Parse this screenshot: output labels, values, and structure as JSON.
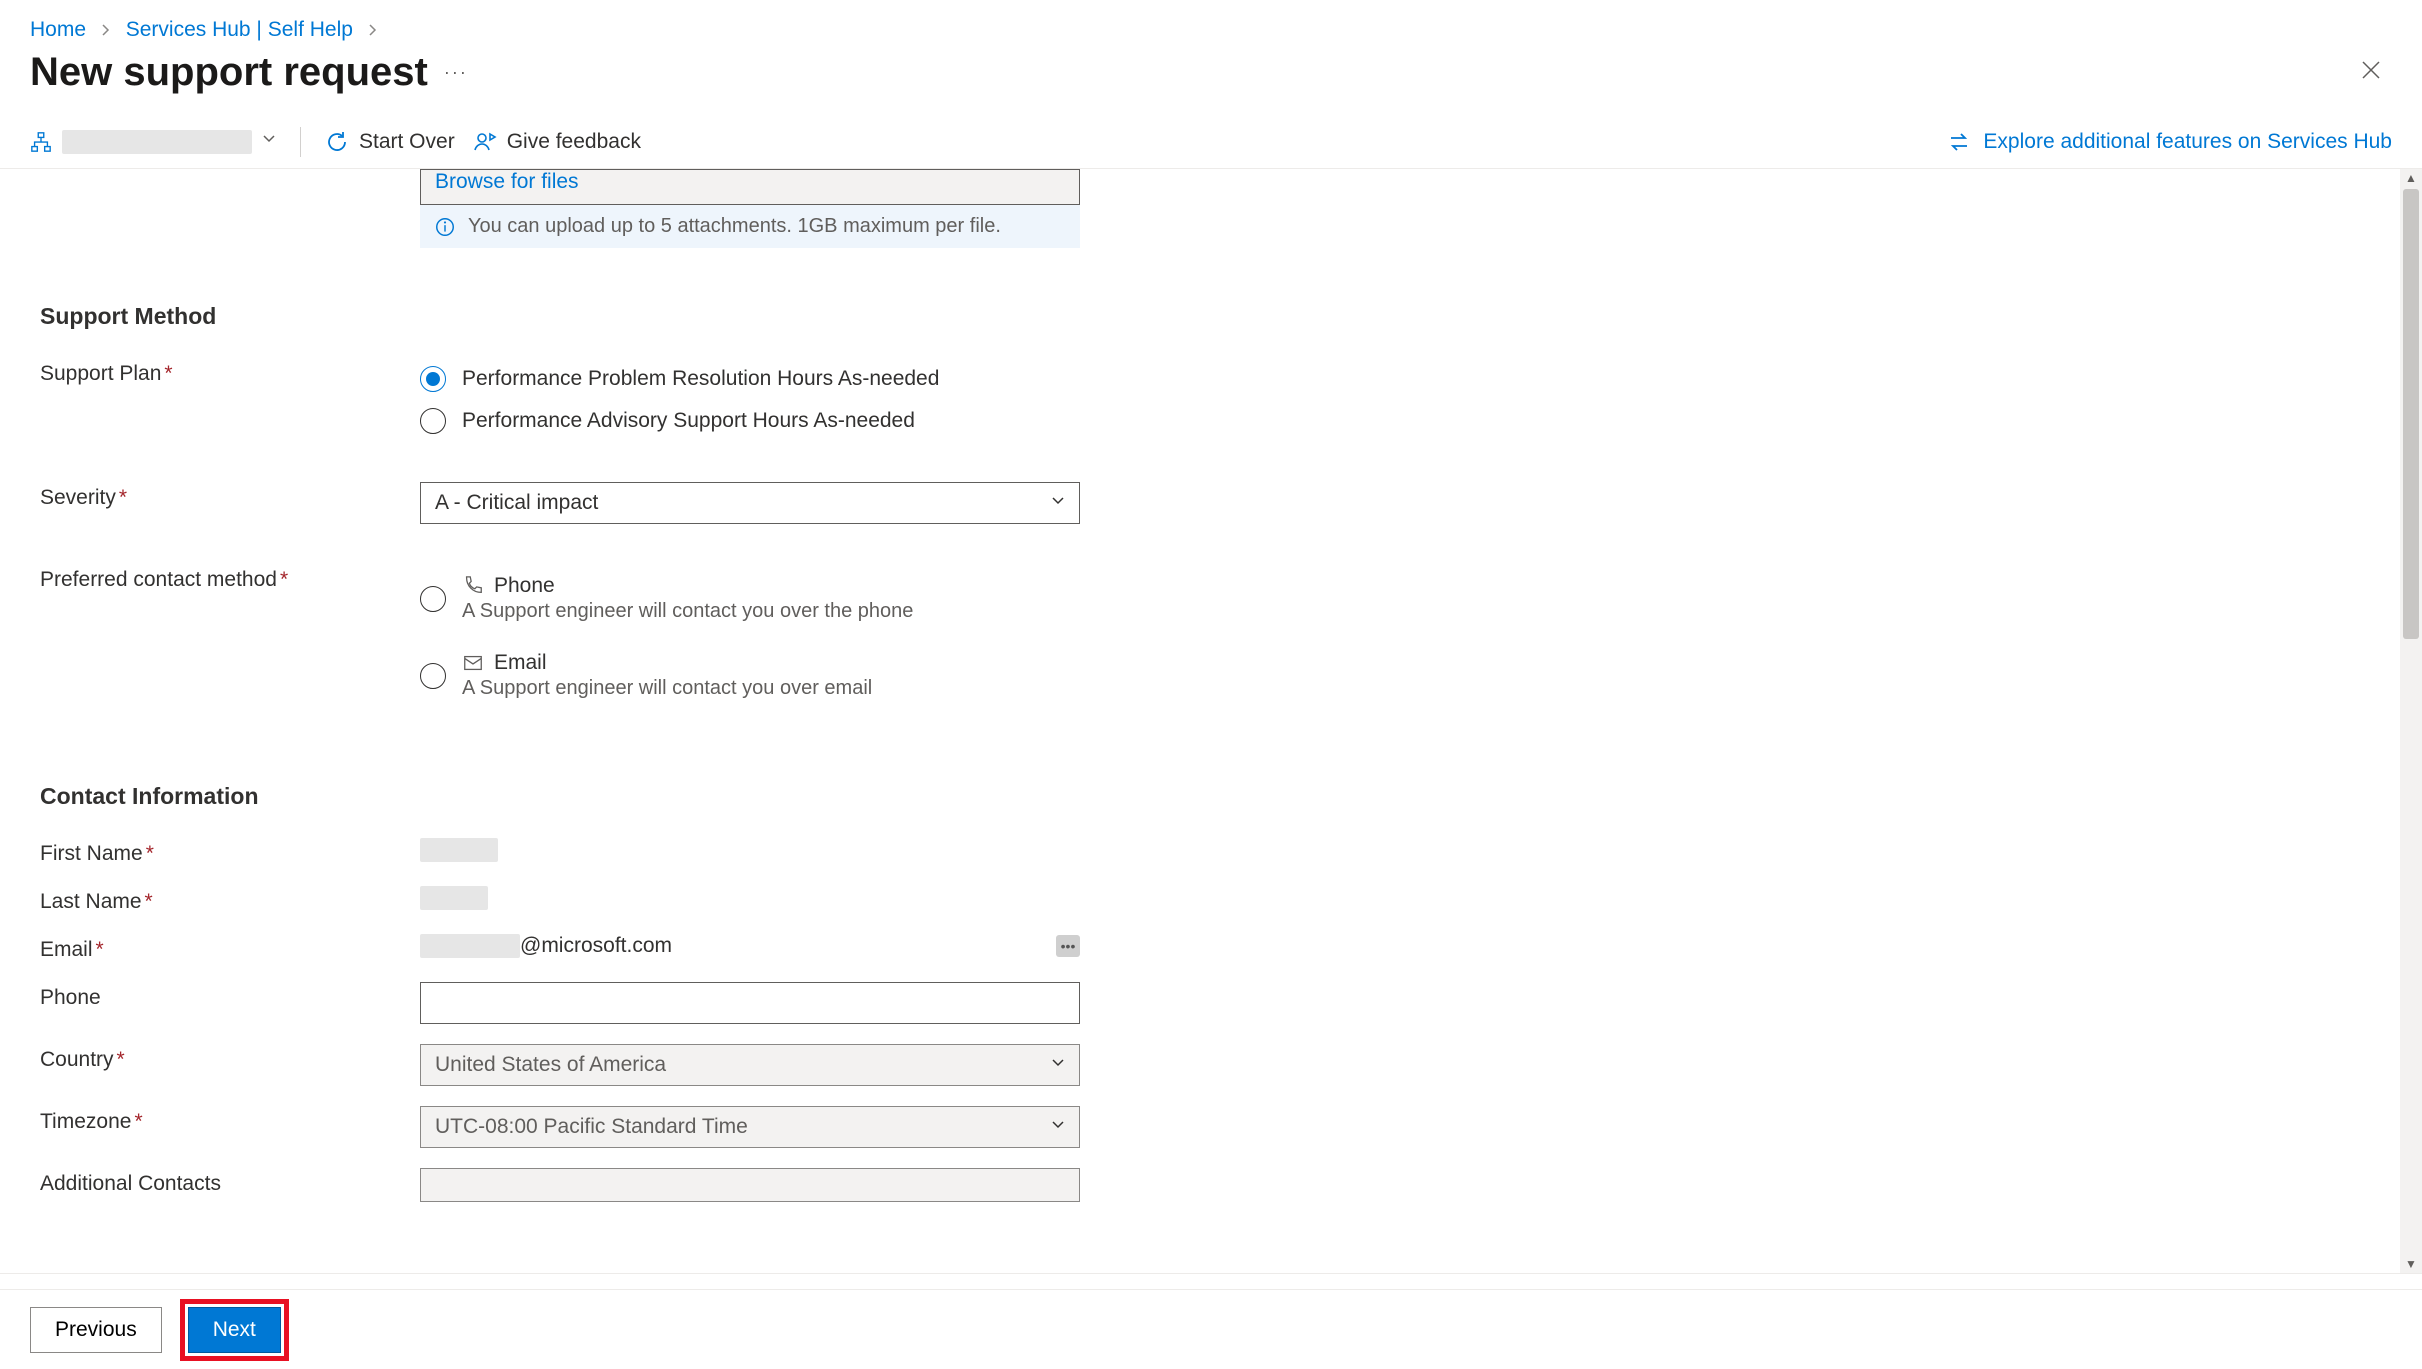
{
  "breadcrumbs": {
    "home": "Home",
    "services_hub": "Services Hub | Self Help"
  },
  "header": {
    "title": "New support request",
    "more": "···"
  },
  "toolbar": {
    "start_over": "Start Over",
    "give_feedback": "Give feedback",
    "explore": "Explore additional features on Services Hub"
  },
  "file_upload": {
    "browse": "Browse for files",
    "info": "You can upload up to 5 attachments. 1GB maximum per file."
  },
  "sections": {
    "support_method": "Support Method",
    "contact_info": "Contact Information"
  },
  "labels": {
    "support_plan": "Support Plan",
    "severity": "Severity",
    "preferred_contact": "Preferred contact method",
    "first_name": "First Name",
    "last_name": "Last Name",
    "email": "Email",
    "phone": "Phone",
    "country": "Country",
    "timezone": "Timezone",
    "additional_contacts": "Additional Contacts"
  },
  "support_plan": {
    "option1": "Performance Problem Resolution Hours As-needed",
    "option2": "Performance Advisory Support Hours As-needed"
  },
  "severity": {
    "value": "A - Critical impact"
  },
  "contact_method": {
    "phone_label": "Phone",
    "phone_desc": "A Support engineer will contact you over the phone",
    "email_label": "Email",
    "email_desc": "A Support engineer will contact you over email"
  },
  "contact": {
    "email_suffix": "@microsoft.com",
    "country_value": "United States of America",
    "timezone_value": "UTC-08:00 Pacific Standard Time"
  },
  "footer": {
    "previous": "Previous",
    "next": "Next"
  }
}
